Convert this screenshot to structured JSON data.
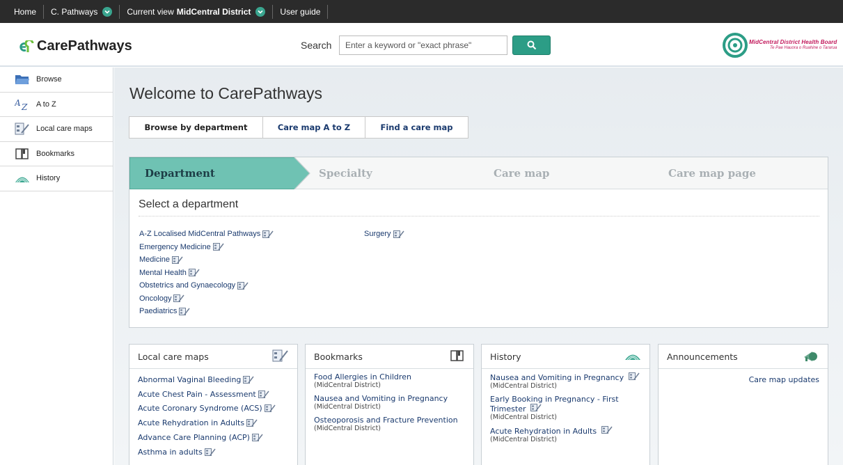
{
  "topbar": {
    "home": "Home",
    "pathways": "C. Pathways",
    "current_view_label": "Current view",
    "current_view_value": "MidCentral District",
    "user_guide": "User guide"
  },
  "header": {
    "logo_text": "CarePathways",
    "search_label": "Search",
    "search_placeholder": "Enter a keyword or \"exact phrase\"",
    "brand_title": "MidCentral District Health Board",
    "brand_subtitle": "Te Pae Hauora o Ruahine o Tararua"
  },
  "sidebar": {
    "items": [
      {
        "label": "Browse",
        "icon": "folder-icon"
      },
      {
        "label": "A to Z",
        "icon": "atoz-icon"
      },
      {
        "label": "Local care maps",
        "icon": "care-map-icon"
      },
      {
        "label": "Bookmarks",
        "icon": "book-icon"
      },
      {
        "label": "History",
        "icon": "history-icon"
      }
    ]
  },
  "main": {
    "welcome": "Welcome to CarePathways",
    "tabs": [
      "Browse by department",
      "Care map A to Z",
      "Find a care map"
    ],
    "steps": [
      "Department",
      "Specialty",
      "Care map",
      "Care map page"
    ],
    "select_title": "Select a department",
    "departments_col1": [
      "A-Z Localised MidCentral Pathways",
      "Emergency Medicine",
      "Medicine",
      "Mental Health",
      "Obstetrics and Gynaecology",
      "Oncology",
      "Paediatrics"
    ],
    "departments_col2": [
      "Surgery"
    ]
  },
  "cards": {
    "local_care_maps": {
      "title": "Local care maps",
      "items": [
        "Abnormal Vaginal Bleeding",
        "Acute Chest Pain - Assessment",
        "Acute Coronary Syndrome (ACS)",
        "Acute Rehydration in Adults",
        "Advance Care Planning (ACP)",
        "Asthma in adults"
      ]
    },
    "bookmarks": {
      "title": "Bookmarks",
      "items": [
        {
          "title": "Food Allergies in Children",
          "sub": "(MidCentral District)"
        },
        {
          "title": "Nausea and Vomiting in Pregnancy",
          "sub": "(MidCentral District)"
        },
        {
          "title": "Osteoporosis and Fracture Prevention",
          "sub": "(MidCentral District)"
        }
      ]
    },
    "history": {
      "title": "History",
      "items": [
        {
          "title": "Nausea and Vomiting in Pregnancy",
          "sub": "(MidCentral District)"
        },
        {
          "title": "Early Booking in Pregnancy - First Trimester",
          "sub": "(MidCentral District)"
        },
        {
          "title": "Acute Rehydration in Adults",
          "sub": "(MidCentral District)"
        }
      ]
    },
    "announcements": {
      "title": "Announcements",
      "link": "Care map updates"
    }
  },
  "colors": {
    "accent": "#2c9d86",
    "step_active": "#6fc2b3",
    "topbar": "#2b2b2b",
    "brand": "#c2185b"
  }
}
